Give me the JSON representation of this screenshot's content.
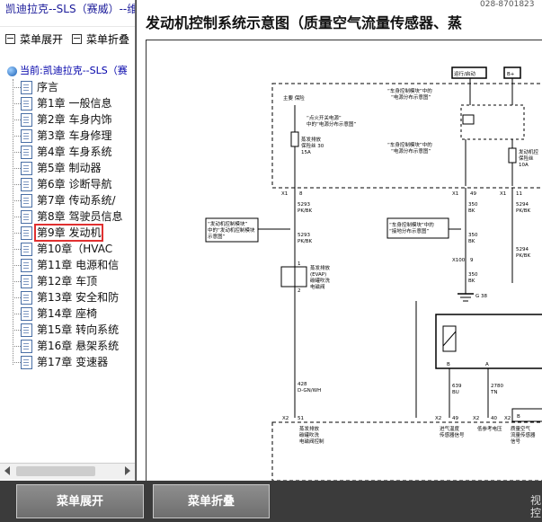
{
  "window_title": "凯迪拉克--SLS（赛威）--维",
  "toolbar": {
    "expand_label": "菜单展开",
    "collapse_label": "菜单折叠"
  },
  "tree": {
    "root_label": "当前:凯迪拉克--SLS（赛",
    "items": [
      {
        "label": "序言"
      },
      {
        "label": "第1章 一般信息"
      },
      {
        "label": "第2章 车身内饰"
      },
      {
        "label": "第3章 车身修理"
      },
      {
        "label": "第4章 车身系统"
      },
      {
        "label": "第5章 制动器"
      },
      {
        "label": "第6章 诊断导航"
      },
      {
        "label": "第7章 传动系统/"
      },
      {
        "label": "第8章 驾驶员信息"
      },
      {
        "label": "第9章 发动机"
      },
      {
        "label": "第10章（HVAC"
      },
      {
        "label": "第11章 电源和信"
      },
      {
        "label": "第12章 车顶"
      },
      {
        "label": "第13章 安全和防"
      },
      {
        "label": "第14章 座椅"
      },
      {
        "label": "第15章 转向系统"
      },
      {
        "label": "第16章 悬架系统"
      },
      {
        "label": "第17章 变速器"
      }
    ],
    "selected_index": 9
  },
  "main": {
    "title": "发动机控制系统示意图（质量空气流量传感器、蒸",
    "top_number": "028-8701823"
  },
  "diagram": {
    "labels": {
      "box_run": "运行/启动",
      "box_bplus": "B+",
      "fuse_block_top": "主要 保险",
      "relay_label1": "“车身控制模块”中的",
      "relay_label1b": "“电源分布示意图”",
      "relay_label2": "“车身控制模块”中的",
      "relay_label2b": "“电源分布示意图”",
      "note_left1": "“点火开关电源”",
      "note_left1b": "中的“电源分布示意图”",
      "fuse_left1": "蒸发排放",
      "fuse_left1b": "保险丝 30",
      "fuse_left1c": "15A",
      "fuse_right1": "发动机控",
      "fuse_right1b": "保险丝",
      "fuse_right1c": "10A",
      "pin_x1_a": "X1",
      "pin_8": "8",
      "pin_x1_b": "X1",
      "pin_49": "49",
      "pin_x1_c": "X1",
      "pin_11": "11",
      "w_5293_a": "5293",
      "w_pkbk_a": "PK/BK",
      "w_350_a": "350",
      "w_bk_a": "BK",
      "w_5294": "5294",
      "w_pkbk_b": "PK/BK",
      "ref_box_left1": "“发动机控制模块”",
      "ref_box_left2": "中的“发动机控制模块",
      "ref_box_left3": "示意图”",
      "ref_box_mid1": "“车身控制模块”中的",
      "ref_box_mid2": "“接地分布示意图”",
      "w_5293_b": "5293",
      "w_pkbk_c": "PK/BK",
      "w_350_b": "350",
      "w_bk_b": "BK",
      "w_5294_b": "5294",
      "w_pkbk_d": "PK/BK",
      "x100": "X100",
      "pin_9": "9",
      "purge_1": "蒸发排放",
      "purge_2": "(EVAP)",
      "purge_3": "碳罐吹洗",
      "purge_4": "电磁阀",
      "pin_1": "1",
      "pin_2": "2",
      "w_428": "428",
      "w_dgnwh": "D-GN/WH",
      "g_label": "G 38",
      "w_350_c": "350",
      "w_bk_c": "BK",
      "pin_b": "B",
      "pin_a": "A",
      "w_639": "639",
      "w_bu": "BU",
      "w_2780": "2780",
      "w_tn": "TN",
      "conn_x2_a": "X2",
      "pin_51": "51",
      "conn_x2_b": "X2",
      "pin_49b": "49",
      "conn_x2_c": "X2",
      "pin_40": "40",
      "conn_x2_d": "X2",
      "pin_b_end": "B",
      "ecm1": "蒸发排放",
      "ecm1b": "碳罐吹洗",
      "ecm1c": "电磁阀控制",
      "ecm2": "进气温度",
      "ecm2b": "传感器信号",
      "ecm3": "低参考电压",
      "ecm4": "质量空气",
      "ecm4b": "流量传感器",
      "ecm4c": "信号"
    }
  },
  "bottom": {
    "expand_label": "菜单展开",
    "collapse_label": "菜单折叠",
    "right_text": "视控"
  }
}
